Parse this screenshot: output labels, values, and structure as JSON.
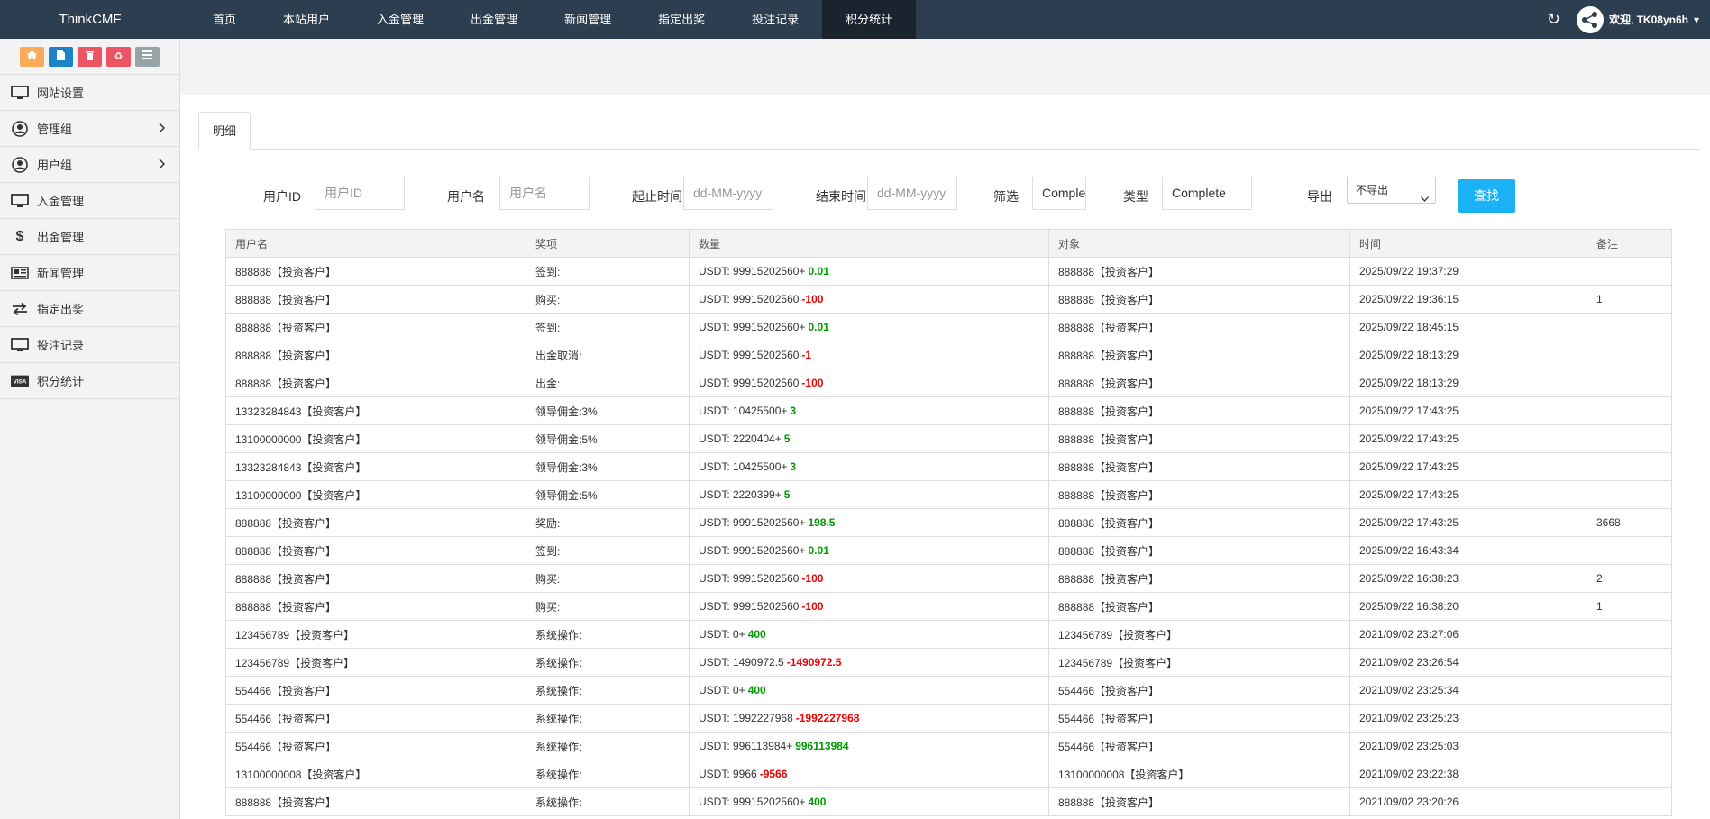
{
  "app": {
    "brand": "ThinkCMF"
  },
  "topnav": [
    {
      "label": "首页",
      "active": false
    },
    {
      "label": "本站用户",
      "active": false
    },
    {
      "label": "入金管理",
      "active": false
    },
    {
      "label": "出金管理",
      "active": false
    },
    {
      "label": "新闻管理",
      "active": false
    },
    {
      "label": "指定出奖",
      "active": false
    },
    {
      "label": "投注记录",
      "active": false
    },
    {
      "label": "积分统计",
      "active": true
    }
  ],
  "user": {
    "welcome": "欢迎, TK08yn6h"
  },
  "quick_buttons": [
    {
      "icon": "home-icon",
      "color": "#f8ac59"
    },
    {
      "icon": "document-icon",
      "color": "#1c84c6"
    },
    {
      "icon": "trash-icon",
      "color": "#ed5565"
    },
    {
      "icon": "recycle-icon",
      "color": "#ed5565"
    },
    {
      "icon": "list-icon",
      "color": "#95a5a6"
    }
  ],
  "sidebar": [
    {
      "label": "网站设置",
      "icon": "monitor-icon",
      "has_children": false
    },
    {
      "label": "管理组",
      "icon": "user-circle-icon",
      "has_children": true
    },
    {
      "label": "用户组",
      "icon": "user-circle-icon",
      "has_children": true
    },
    {
      "label": "入金管理",
      "icon": "monitor-icon",
      "has_children": false
    },
    {
      "label": "出金管理",
      "icon": "dollar-icon",
      "has_children": false
    },
    {
      "label": "新闻管理",
      "icon": "newspaper-icon",
      "has_children": false
    },
    {
      "label": "指定出奖",
      "icon": "exchange-icon",
      "has_children": false
    },
    {
      "label": "投注记录",
      "icon": "monitor-icon",
      "has_children": false
    },
    {
      "label": "积分统计",
      "icon": "visa-card-icon",
      "has_children": false
    }
  ],
  "tab": {
    "label": "明细"
  },
  "filters": {
    "user_id": {
      "label": "用户ID",
      "placeholder": "用户ID"
    },
    "username": {
      "label": "用户名",
      "placeholder": "用户名"
    },
    "start_time": {
      "label": "起止时间",
      "placeholder": "dd-MM-yyyy"
    },
    "end_time": {
      "label": "结束时间",
      "placeholder": "dd-MM-yyyy"
    },
    "filter": {
      "label": "筛选",
      "value": "Comple"
    },
    "type": {
      "label": "类型",
      "value": "Complete"
    },
    "export": {
      "label": "导出",
      "value": "不导出"
    },
    "search_label": "查找"
  },
  "table": {
    "columns": [
      "用户名",
      "奖项",
      "数量",
      "对象",
      "时间",
      "备注"
    ],
    "rows": [
      {
        "user": "888888【投资客户】",
        "award": "签到:",
        "amount_prefix": "USDT: 99915202560+",
        "amount_delta": "0.01",
        "delta_sign": "pos",
        "target": "888888【投资客户】",
        "time": "2025/09/22 19:37:29",
        "note": ""
      },
      {
        "user": "888888【投资客户】",
        "award": "购买:",
        "amount_prefix": "USDT: 99915202560",
        "amount_delta": "-100",
        "delta_sign": "neg",
        "target": "888888【投资客户】",
        "time": "2025/09/22 19:36:15",
        "note": "1"
      },
      {
        "user": "888888【投资客户】",
        "award": "签到:",
        "amount_prefix": "USDT: 99915202560+",
        "amount_delta": "0.01",
        "delta_sign": "pos",
        "target": "888888【投资客户】",
        "time": "2025/09/22 18:45:15",
        "note": ""
      },
      {
        "user": "888888【投资客户】",
        "award": "出金取消:",
        "amount_prefix": "USDT: 99915202560",
        "amount_delta": "-1",
        "delta_sign": "neg",
        "target": "888888【投资客户】",
        "time": "2025/09/22 18:13:29",
        "note": ""
      },
      {
        "user": "888888【投资客户】",
        "award": "出金:",
        "amount_prefix": "USDT: 99915202560",
        "amount_delta": "-100",
        "delta_sign": "neg",
        "target": "888888【投资客户】",
        "time": "2025/09/22 18:13:29",
        "note": ""
      },
      {
        "user": "13323284843【投资客户】",
        "award": "领导佣金:3%",
        "amount_prefix": "USDT: 10425500+",
        "amount_delta": "3",
        "delta_sign": "pos",
        "target": "888888【投资客户】",
        "time": "2025/09/22 17:43:25",
        "note": ""
      },
      {
        "user": "13100000000【投资客户】",
        "award": "领导佣金:5%",
        "amount_prefix": "USDT: 2220404+",
        "amount_delta": "5",
        "delta_sign": "pos",
        "target": "888888【投资客户】",
        "time": "2025/09/22 17:43:25",
        "note": ""
      },
      {
        "user": "13323284843【投资客户】",
        "award": "领导佣金:3%",
        "amount_prefix": "USDT: 10425500+",
        "amount_delta": "3",
        "delta_sign": "pos",
        "target": "888888【投资客户】",
        "time": "2025/09/22 17:43:25",
        "note": ""
      },
      {
        "user": "13100000000【投资客户】",
        "award": "领导佣金:5%",
        "amount_prefix": "USDT: 2220399+",
        "amount_delta": "5",
        "delta_sign": "pos",
        "target": "888888【投资客户】",
        "time": "2025/09/22 17:43:25",
        "note": ""
      },
      {
        "user": "888888【投资客户】",
        "award": "奖励:",
        "amount_prefix": "USDT: 99915202560+",
        "amount_delta": "198.5",
        "delta_sign": "pos",
        "target": "888888【投资客户】",
        "time": "2025/09/22 17:43:25",
        "note": "3668"
      },
      {
        "user": "888888【投资客户】",
        "award": "签到:",
        "amount_prefix": "USDT: 99915202560+",
        "amount_delta": "0.01",
        "delta_sign": "pos",
        "target": "888888【投资客户】",
        "time": "2025/09/22 16:43:34",
        "note": ""
      },
      {
        "user": "888888【投资客户】",
        "award": "购买:",
        "amount_prefix": "USDT: 99915202560",
        "amount_delta": "-100",
        "delta_sign": "neg",
        "target": "888888【投资客户】",
        "time": "2025/09/22 16:38:23",
        "note": "2"
      },
      {
        "user": "888888【投资客户】",
        "award": "购买:",
        "amount_prefix": "USDT: 99915202560",
        "amount_delta": "-100",
        "delta_sign": "neg",
        "target": "888888【投资客户】",
        "time": "2025/09/22 16:38:20",
        "note": "1"
      },
      {
        "user": "123456789【投资客户】",
        "award": "系统操作:",
        "amount_prefix": "USDT: 0+",
        "amount_delta": "400",
        "delta_sign": "pos",
        "target": "123456789【投资客户】",
        "time": "2021/09/02 23:27:06",
        "note": ""
      },
      {
        "user": "123456789【投资客户】",
        "award": "系统操作:",
        "amount_prefix": "USDT: 1490972.5",
        "amount_delta": "-1490972.5",
        "delta_sign": "neg",
        "target": "123456789【投资客户】",
        "time": "2021/09/02 23:26:54",
        "note": ""
      },
      {
        "user": "554466【投资客户】",
        "award": "系统操作:",
        "amount_prefix": "USDT: 0+",
        "amount_delta": "400",
        "delta_sign": "pos",
        "target": "554466【投资客户】",
        "time": "2021/09/02 23:25:34",
        "note": ""
      },
      {
        "user": "554466【投资客户】",
        "award": "系统操作:",
        "amount_prefix": "USDT: 1992227968",
        "amount_delta": "-1992227968",
        "delta_sign": "neg",
        "target": "554466【投资客户】",
        "time": "2021/09/02 23:25:23",
        "note": ""
      },
      {
        "user": "554466【投资客户】",
        "award": "系统操作:",
        "amount_prefix": "USDT: 996113984+",
        "amount_delta": "996113984",
        "delta_sign": "pos",
        "target": "554466【投资客户】",
        "time": "2021/09/02 23:25:03",
        "note": ""
      },
      {
        "user": "13100000008【投资客户】",
        "award": "系统操作:",
        "amount_prefix": "USDT: 9966",
        "amount_delta": "-9566",
        "delta_sign": "neg",
        "target": "13100000008【投资客户】",
        "time": "2021/09/02 23:22:38",
        "note": ""
      },
      {
        "user": "888888【投资客户】",
        "award": "系统操作:",
        "amount_prefix": "USDT: 99915202560+",
        "amount_delta": "400",
        "delta_sign": "pos",
        "target": "888888【投资客户】",
        "time": "2021/09/02 23:20:26",
        "note": ""
      }
    ]
  }
}
